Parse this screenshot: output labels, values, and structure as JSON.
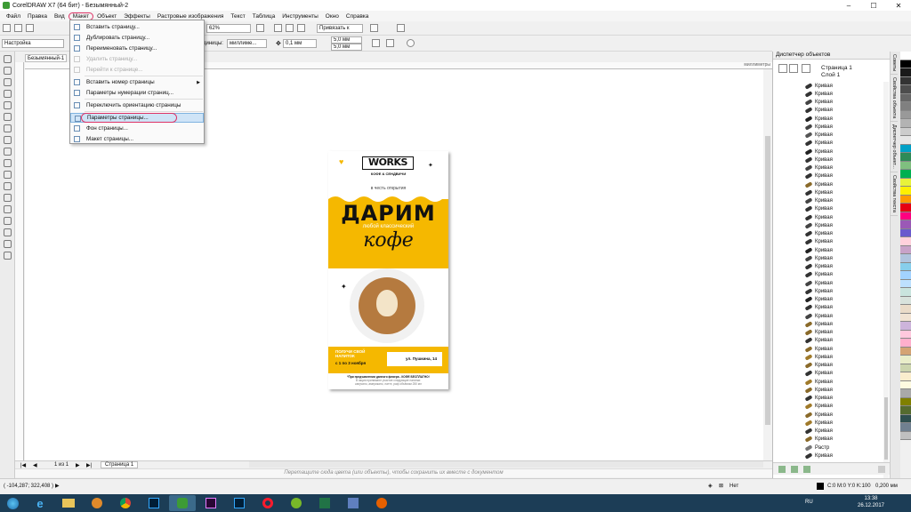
{
  "window": {
    "title": "CorelDRAW X7 (64 бит) - Безымянный-2",
    "min": "–",
    "max": "☐",
    "close": "✕"
  },
  "menu": {
    "items": [
      "Файл",
      "Правка",
      "Вид",
      "Макет",
      "Объект",
      "Эффекты",
      "Растровые изображения",
      "Текст",
      "Таблица",
      "Инструменты",
      "Окно",
      "Справка"
    ]
  },
  "dropdown": {
    "items": [
      {
        "label": "Вставить страницу...",
        "disabled": false
      },
      {
        "label": "Дублировать страницу...",
        "disabled": false
      },
      {
        "label": "Переименовать страницу...",
        "disabled": false
      },
      {
        "label": "Удалить страницу...",
        "disabled": true
      },
      {
        "label": "Перейти к странице...",
        "disabled": true
      },
      {
        "label": "Вставить номер страницы",
        "disabled": false,
        "submenu": true
      },
      {
        "label": "Параметры нумерации страниц...",
        "disabled": false
      },
      {
        "label": "Переключить ориентацию страницы",
        "disabled": false
      },
      {
        "label": "Параметры страницы...",
        "disabled": false,
        "highlighted": true
      },
      {
        "label": "Фон страницы...",
        "disabled": false
      },
      {
        "label": "Макет страницы...",
        "disabled": false
      }
    ]
  },
  "toolbar": {
    "zoom": "62%",
    "snap": "Привязать к",
    "preset": "Настройка",
    "units_label": "Единицы:",
    "units": "миллиме...",
    "nudge": "0,1 мм",
    "dup_x": "5,0 мм",
    "dup_y": "5,0 мм"
  },
  "document_tab": "Безымянный-1",
  "ruler_unit": "миллиметры",
  "page_nav": {
    "counter": "1 из 1",
    "page_tab": "Страница 1"
  },
  "color_hint": "Перетащите сюда цвета (или объекты), чтобы сохранить их вместе с документом",
  "status": {
    "coords": "( -104,287; 322,408 )",
    "fill_label": "Нет",
    "color": "C:0 M:0 Y:0 K:100",
    "outline": "0,200 мм"
  },
  "docker": {
    "title": "Диспетчер объектов",
    "page": "Страница 1",
    "layer": "Слой 1",
    "objects": [
      "Кривая",
      "Кривая",
      "Кривая",
      "Кривая",
      "Кривая",
      "Кривая",
      "Кривая",
      "Кривая",
      "Кривая",
      "Кривая",
      "Кривая",
      "Кривая",
      "Кривая",
      "Кривая",
      "Кривая",
      "Кривая",
      "Кривая",
      "Кривая",
      "Кривая",
      "Кривая",
      "Кривая",
      "Кривая",
      "Кривая",
      "Кривая",
      "Кривая",
      "Кривая",
      "Кривая",
      "Кривая",
      "Кривая",
      "Кривая",
      "Кривая",
      "Кривая",
      "Кривая",
      "Кривая",
      "Кривая",
      "Кривая",
      "Кривая",
      "Кривая",
      "Кривая",
      "Кривая",
      "Кривая",
      "Кривая",
      "Кривая",
      "Кривая",
      "Растр",
      "Кривая"
    ],
    "vtabs": [
      "Советы",
      "Свойства объекта",
      "Диспетчер объект...",
      "Свойства текста"
    ]
  },
  "flyer": {
    "logo": "WORKS",
    "subtitle": "КОФЕ & СЕНДВИЧИ",
    "tagline": "в честь открытия",
    "headline": "ДАРИМ",
    "line2": "любой классический",
    "coffee": "кофе",
    "promo1": "ПОЛУЧИ СВОЙ НАПИТОК",
    "promo2": "с 1 по 3 ноября",
    "address": "ул. Пушкина, 14",
    "fine_title": "*При предъявлении данного флаера - КОФЕ БЕСПЛАТНО!",
    "fine1": "В акции принимают участие следующие напитки:",
    "fine2": "капучино, американо, латте, раф объёмом 250 мл"
  },
  "tray": {
    "lang": "RU",
    "time": "13:38",
    "date": "26.12.2017"
  },
  "colors": {
    "yellow": "#f5b800",
    "corel_green": "#3d9b35"
  }
}
